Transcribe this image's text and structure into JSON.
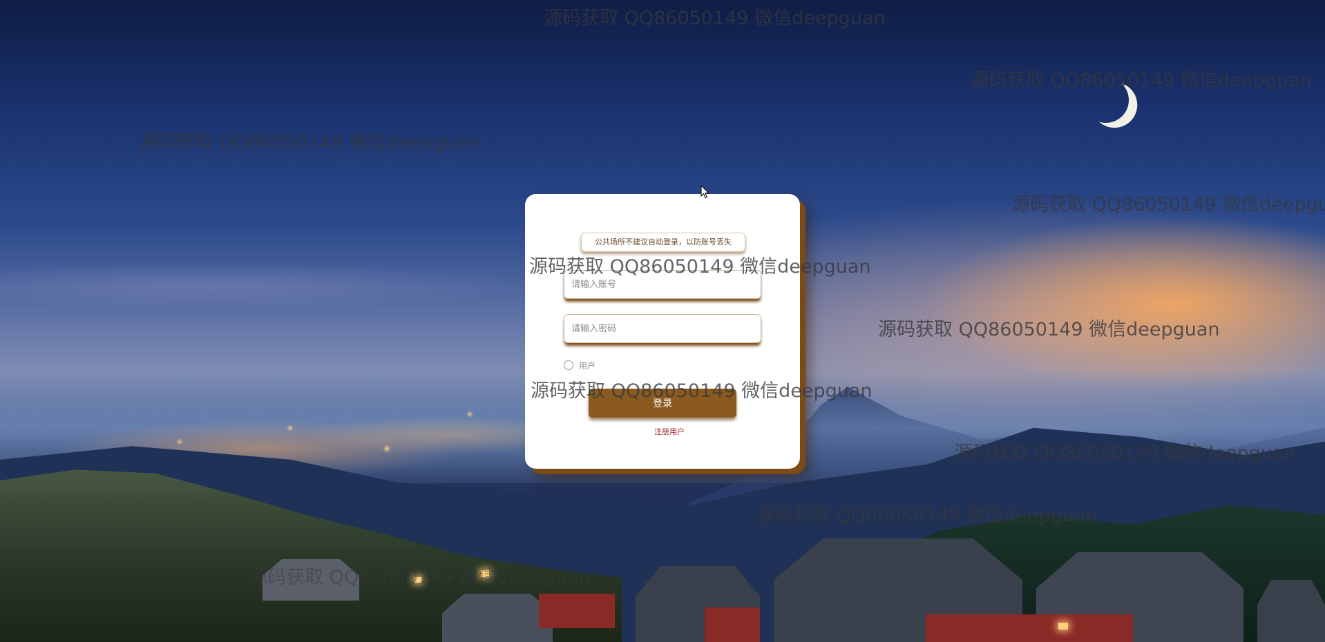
{
  "watermark_text": "源码获取 QQ86050149 微信deepguan",
  "login": {
    "notice": "公共场所不建议自动登录，以防账号丢失",
    "account_placeholder": "请输入账号",
    "password_placeholder": "请输入密码",
    "role_label": "用户",
    "login_button": "登录",
    "register_link": "注册用户"
  },
  "colors": {
    "accent": "#8a5a1f",
    "shadow": "#7a4a17",
    "link": "#a0202a"
  },
  "icons": {
    "cursor": "mouse-pointer-icon"
  }
}
